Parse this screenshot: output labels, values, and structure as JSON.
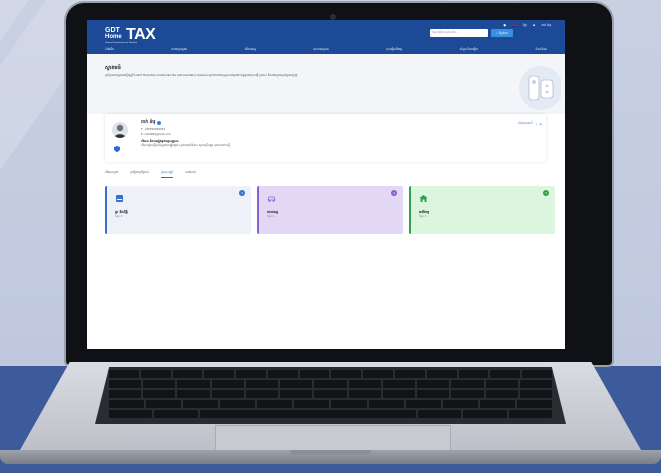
{
  "colors": {
    "header_bg": "#1d4a96",
    "card_1_bg": "#eef2f8",
    "card_1_accent": "#3a70c8",
    "card_2_bg": "#e3d7f6",
    "card_2_accent": "#8a5fd4",
    "card_3_bg": "#dcf5df",
    "card_3_accent": "#2fa24a",
    "background_bottom": "#3d5a9a"
  },
  "header": {
    "logo": {
      "line1": "GDT",
      "line2": "Home",
      "mark": "TAX",
      "tagline": "General Department of Taxation"
    },
    "top_actions": [
      "ខ្មែរ",
      "ចាក់ ឆ៉ារុ"
    ],
    "search_placeholder": "ស្វែងរកអ្វីដែលអ្នកចង់ដឹង...",
    "search_button": "ស្វែងរក"
  },
  "nav": {
    "items": [
      "ទំព័រដើម",
      "សេវាកម្មពន្ធដារ",
      "ព័ត៌មានពន្ធ",
      "ឯកសារពន្ធដារ",
      "ចុះបញ្ជីអាជីវកម្ម",
      "សំណួរ និងចម្លើយ",
      "ទំនាក់ទំនង"
    ]
  },
  "banner": {
    "title": "ស្វាគមន៍",
    "description": "ប្រព័ន្ធសេវាពន្ធដារអេឡិចត្រូនិក GDT HomeTax (Cambodia Tax Administration System) ផ្តល់ភាពងាយស្រួលដល់អ្នកជាប់ពន្ធក្នុងការចុះបញ្ជី ប្រកាស និងបង់ពន្ធតាមប្រព័ន្ធអនឡាញ"
  },
  "profile": {
    "name": "ចាក់ ឆ៉ារុ",
    "phone": "T: +85599999991",
    "email": "E: sok999@gmail.com",
    "status_title": "ព័ត៌មាន និងការផ្ទៀងផ្ទាត់អត្តសញ្ញាណ",
    "status_desc": "ព័ត៌មានអ្នកប្រើប្រាស់ត្រូវបានផ្ទៀងផ្ទាត់ សូមបញ្ជាក់ព័ត៌មាន ឲ្យបានត្រឹមត្រូវ មុនពេលដាក់ស្នើ",
    "right_link": "ព័ត៌មានគណនី"
  },
  "tabs": [
    {
      "label": "ព័ត៌មានទូទៅ",
      "active": false
    },
    {
      "label": "ប្រវត្តិការប្រើប្រាស់",
      "active": false
    },
    {
      "label": "ទ្រព្យសម្បត្តិ",
      "active": true
    },
    {
      "label": "ការកំណត់",
      "active": false
    }
  ],
  "cards": [
    {
      "label": "ផ្ទះ និងដីធ្លី",
      "sub": "ចំនួន 2",
      "badge": "2",
      "icon": "house-icon"
    },
    {
      "label": "យានយន្ត",
      "sub": "ចំនួន 4",
      "badge": "4",
      "icon": "car-icon"
    },
    {
      "label": "អាជីវកម្ម",
      "sub": "ចំនួន 3",
      "badge": "3",
      "icon": "store-icon"
    }
  ]
}
